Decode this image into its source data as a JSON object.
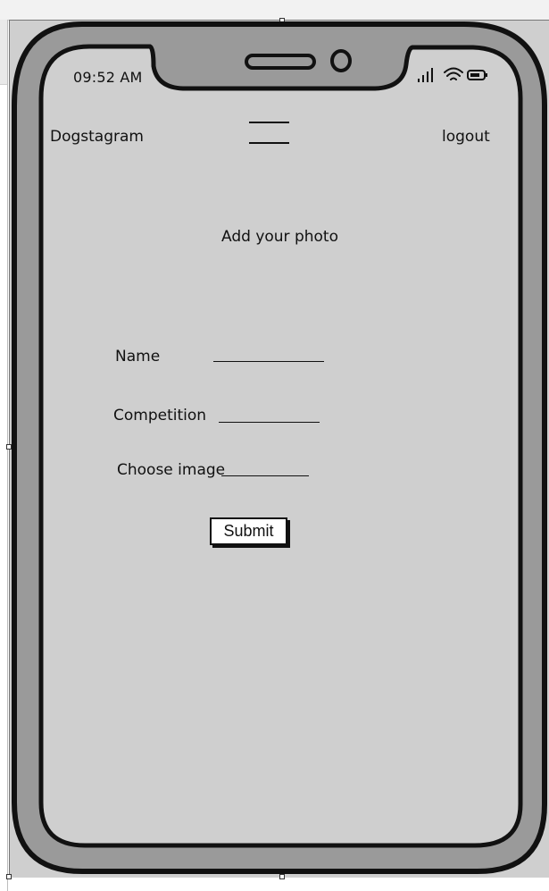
{
  "status_bar": {
    "time": "09:52 AM",
    "icons": [
      "signal-icon",
      "wifi-icon",
      "battery-icon"
    ]
  },
  "navbar": {
    "brand": "Dogstagram",
    "menu_icon": "hamburger-menu-icon",
    "logout_label": "logout"
  },
  "main": {
    "title": "Add your photo",
    "fields": [
      {
        "label": "Name",
        "value": ""
      },
      {
        "label": "Competition",
        "value": ""
      },
      {
        "label": "Choose image",
        "value": ""
      }
    ],
    "submit_label": "Submit"
  },
  "colors": {
    "screen": "#cfcfcf",
    "bezel": "#9a9a9a",
    "outline": "#111111",
    "button_bg": "#ffffff"
  }
}
